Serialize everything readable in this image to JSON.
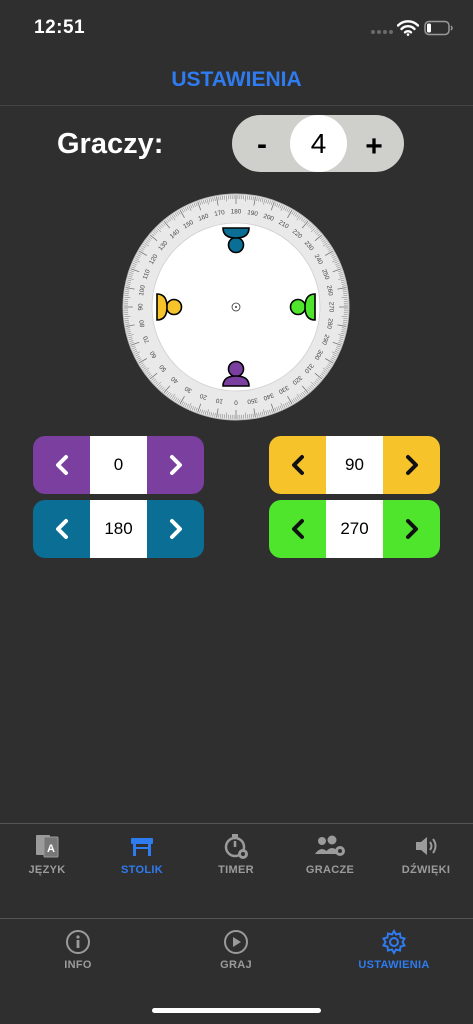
{
  "status_bar": {
    "time": "12:51"
  },
  "header": {
    "title": "USTAWIENIA"
  },
  "players": {
    "label": "Graczy:",
    "minus": "-",
    "plus": "+",
    "count": "4"
  },
  "dial": {
    "tick_labels": [
      "0",
      "10",
      "20",
      "30",
      "40",
      "50",
      "60",
      "70",
      "80",
      "90",
      "100",
      "110",
      "120",
      "130",
      "140",
      "150",
      "160",
      "170",
      "180",
      "190",
      "200",
      "210",
      "220",
      "230",
      "240",
      "250",
      "260",
      "270",
      "280",
      "290",
      "300",
      "310",
      "320",
      "330",
      "340",
      "350"
    ],
    "players": [
      {
        "color": "#7b3fa0",
        "angle": 0
      },
      {
        "color": "#f6c42a",
        "angle": 90
      },
      {
        "color": "#0b6f95",
        "angle": 180
      },
      {
        "color": "#4ee52c",
        "angle": 270
      }
    ]
  },
  "rotations": [
    {
      "id": "purple",
      "value": "0",
      "color": "#7b3fa0"
    },
    {
      "id": "yellow",
      "value": "90",
      "color": "#f6c42a"
    },
    {
      "id": "blue",
      "value": "180",
      "color": "#0b6f95"
    },
    {
      "id": "green",
      "value": "270",
      "color": "#4ee52c"
    }
  ],
  "tabs_top": [
    {
      "label": "JĘZYK",
      "icon": "language-icon",
      "active": false
    },
    {
      "label": "STOLIK",
      "icon": "table-icon",
      "active": true
    },
    {
      "label": "TIMER",
      "icon": "timer-icon",
      "active": false
    },
    {
      "label": "GRACZE",
      "icon": "players-icon",
      "active": false
    },
    {
      "label": "DŹWIĘKI",
      "icon": "speaker-icon",
      "active": false
    }
  ],
  "tabs_bottom": [
    {
      "label": "INFO",
      "icon": "info-icon",
      "active": false
    },
    {
      "label": "GRAJ",
      "icon": "play-icon",
      "active": false
    },
    {
      "label": "USTAWIENIA",
      "icon": "gear-icon",
      "active": true
    }
  ],
  "colors": {
    "accent": "#2f7bf0",
    "inactive": "#9b9b9b",
    "background": "#2f2f2f"
  }
}
